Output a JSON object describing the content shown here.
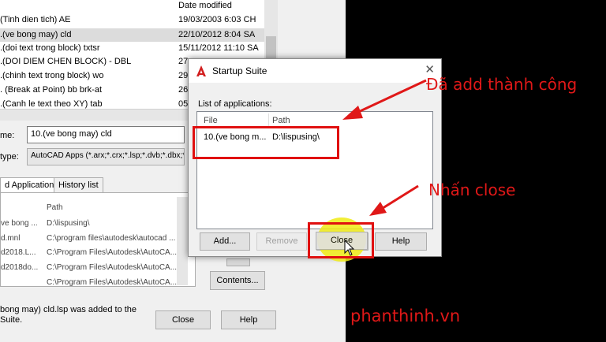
{
  "file_dialog": {
    "column_date": "Date modified",
    "files": [
      {
        "name": "(Tinh dien tich) AE",
        "date": "19/03/2003 6:03 CH",
        "selected": false
      },
      {
        "name": ".(ve bong may) cld",
        "date": "22/10/2012 8:04 SA",
        "selected": true
      },
      {
        "name": ".(doi text trong block) txtsr",
        "date": "15/11/2012 11:10 SA",
        "selected": false
      },
      {
        "name": ".(DOI DIEM CHEN BLOCK) - DBL",
        "date": "27",
        "selected": false
      },
      {
        "name": ".(chinh text trong block) wo",
        "date": "29",
        "selected": false
      },
      {
        "name": ". (Break at Point) bb brk-at",
        "date": "26",
        "selected": false
      },
      {
        "name": ".(Canh le text theo XY) tab",
        "date": "05",
        "selected": false
      }
    ],
    "file_name_label": "me:",
    "file_name_value": "10.(ve bong may) cld",
    "file_type_label": "type:",
    "file_type_value": "AutoCAD Apps (*.arx;*.crx;*.lsp;*.dvb;*.dbx;*.",
    "tabs": [
      "d Applications",
      "History list"
    ],
    "apps_column_path": "Path",
    "apps": [
      {
        "name": "ve bong ...",
        "path": "D:\\lispusing\\"
      },
      {
        "name": "d.mnl",
        "path": "C:\\program files\\autodesk\\autocad ..."
      },
      {
        "name": "d2018.L...",
        "path": "C:\\Program Files\\Autodesk\\AutoCA..."
      },
      {
        "name": "d2018do...",
        "path": "C:\\Program Files\\Autodesk\\AutoCA..."
      },
      {
        "name": "",
        "path": "C:\\Program Files\\Autodesk\\AutoCA..."
      }
    ],
    "status": "bong may) cld.lsp was added to the Suite.",
    "close_label": "Close",
    "help_label": "Help",
    "contents_label": "Contents..."
  },
  "startup_suite": {
    "title": "Startup Suite",
    "close_glyph": "✕",
    "list_label": "List of applications:",
    "col_file": "File",
    "col_path": "Path",
    "row_file": "10.(ve bong m...",
    "row_path": "D:\\lispusing\\",
    "buttons": {
      "add": "Add...",
      "remove": "Remove",
      "close": "Close",
      "help": "Help"
    }
  },
  "annotations": {
    "added_success": "Đã add thành công",
    "press_close": "Nhấn close",
    "watermark": "phanthinh.vn",
    "color": "#e01818"
  }
}
